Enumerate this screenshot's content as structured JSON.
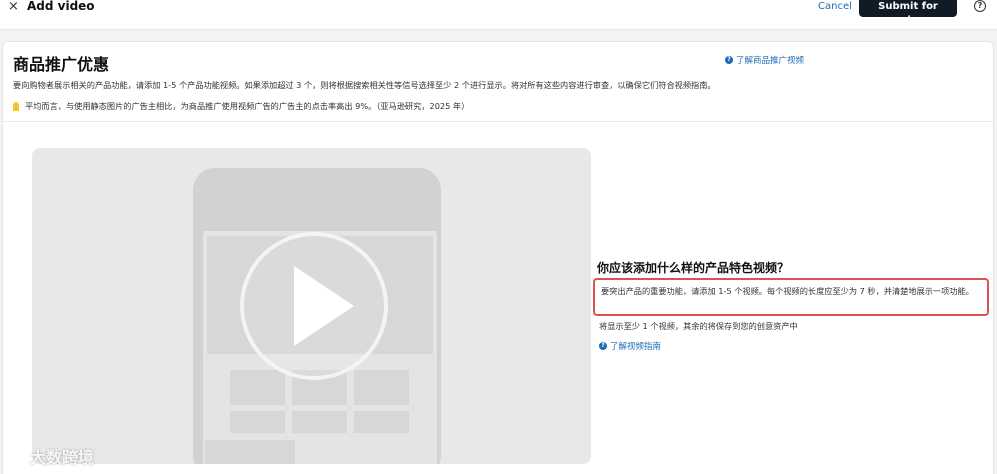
{
  "header": {
    "close_glyph": "×",
    "title": "Add video",
    "cancel_label": "Cancel",
    "submit_label": "Submit for review",
    "help_glyph": "?"
  },
  "card": {
    "title": "商品推广优惠",
    "learn_link": "了解商品推广视频",
    "description": "要向购物者展示相关的产品功能，请添加 1-5 个产品功能视频。如果添加超过 3 个，则将根据搜索相关性等信号选择至少 2 个进行显示。将对所有这些内容进行审查，以确保它们符合视频指南。",
    "stat": "平均而言，与使用静态图片的广告主相比，为商品推广使用视频广告的广告主的点击率高出 9%。（亚马逊研究，2025 年）"
  },
  "info": {
    "title": "你应该添加什么样的产品特色视频？",
    "highlight": "要突出产品的重要功能，请添加 1-5 个视频。每个视频的长度应至少为 7 秒，并清楚地展示一项功能。",
    "note": "将显示至少 1 个视频，其余的将保存到您的创意资产中",
    "learn_link": "了解视频指南"
  },
  "watermark": {
    "text": "大数跨境"
  },
  "colors": {
    "accent": "#1d6cb5",
    "submit_bg": "#111b26",
    "highlight_border": "#d9534f"
  }
}
